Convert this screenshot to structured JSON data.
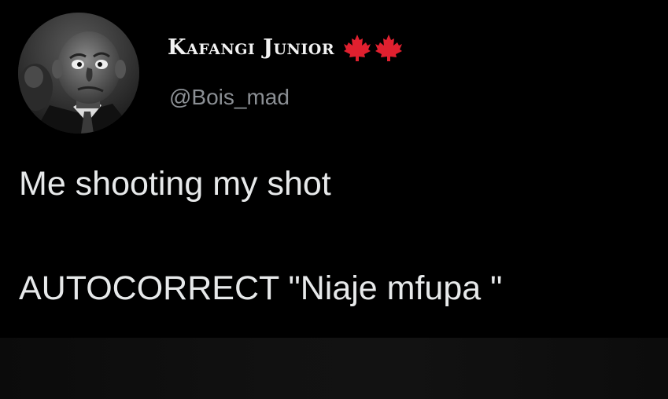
{
  "tweet": {
    "author": {
      "display_name": "Kafangi Junior",
      "handle": "@Bois_mad",
      "badges": [
        "maple-leaf-icon",
        "maple-leaf-icon"
      ],
      "avatar": "profile-photo-grayscale"
    },
    "text": {
      "line1": "Me shooting my shot",
      "line2": "AUTOCORRECT \"Niaje mfupa \""
    }
  },
  "colors": {
    "background": "#000000",
    "text": "#e7e9ea",
    "handle": "#8b8f94",
    "flag_red": "#e0202f"
  }
}
